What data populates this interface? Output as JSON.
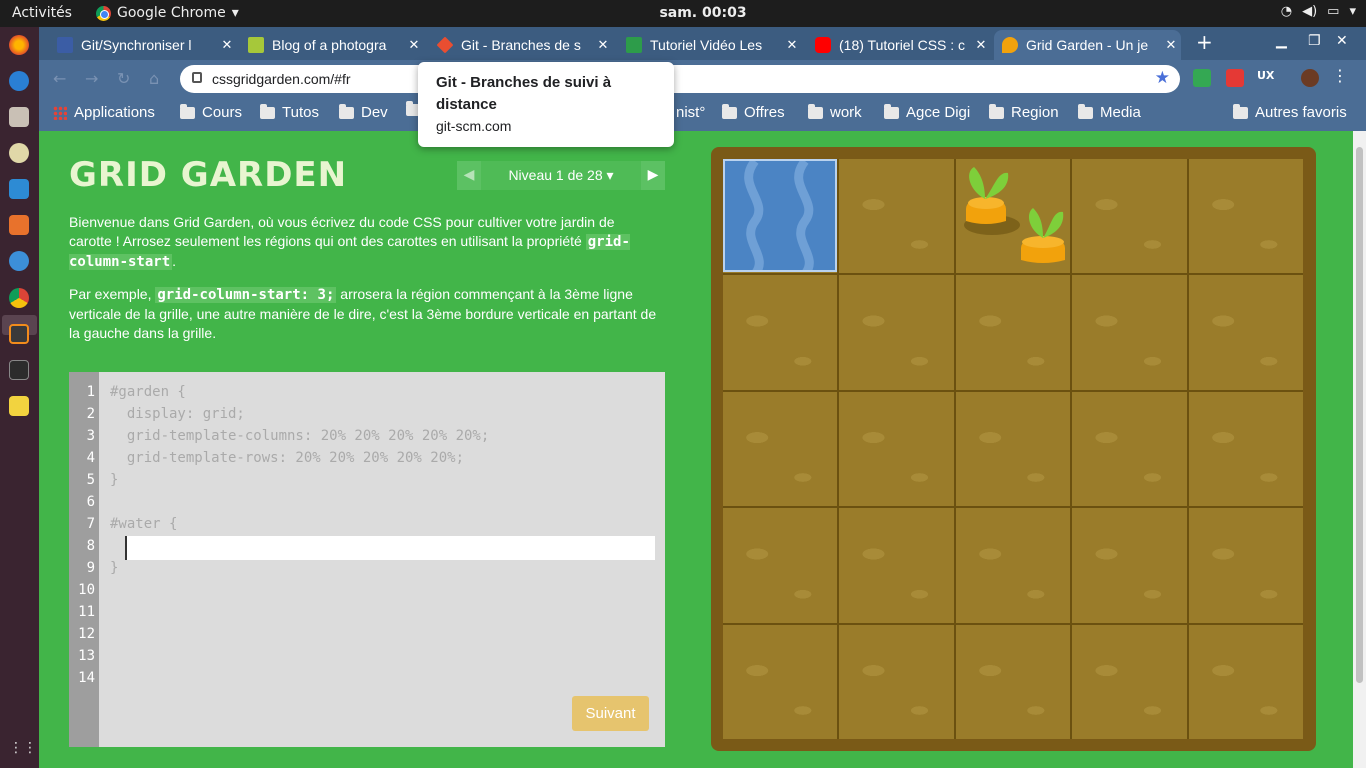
{
  "system": {
    "activities": "Activités",
    "app_name": "Google Chrome",
    "clock": "sam. 00:03"
  },
  "tabs": [
    {
      "title": "Git/Synchroniser l",
      "active": false
    },
    {
      "title": "Blog of a photogra",
      "active": false
    },
    {
      "title": "Git - Branches de s",
      "active": false
    },
    {
      "title": "Tutoriel Vidéo Les",
      "active": false
    },
    {
      "title": "(18) Tutoriel CSS : c",
      "active": false
    },
    {
      "title": "Grid Garden - Un je",
      "active": true
    }
  ],
  "new_tab_label": "+",
  "address_bar": {
    "url": "cssgridgarden.com/#fr"
  },
  "bookmarks": {
    "apps_label": "Applications",
    "folders": [
      "Cours",
      "Tutos",
      "Dev",
      "",
      "nist°",
      "Offres",
      "work",
      "Agce Digi",
      "Region",
      "Media"
    ],
    "other": "Autres favoris"
  },
  "tooltip": {
    "title": "Git - Branches de suivi à distance",
    "domain": "git-scm.com"
  },
  "game": {
    "title": "GRID GARDEN",
    "level_label": "Niveau 1 de 28 ▾",
    "prev_arrow": "◀",
    "next_arrow": "▶",
    "intro_1": "Bienvenue dans Grid Garden, où vous écrivez du code CSS pour cultiver votre jardin de carotte ! Arrosez seulement les régions qui ont des carottes en utilisant la propriété ",
    "intro_code": "grid-column-start",
    "intro_end": ".",
    "example_1": "Par exemple, ",
    "example_code": "grid-column-start: 3;",
    "example_2": " arrosera la région commençant à la 3ème ligne verticale de la grille, une autre manière de le dire, c'est la 3ème bordure verticale en partant de la gauche dans la grille.",
    "next_button": "Suivant",
    "code_lines": [
      "#garden {",
      "  display: grid;",
      "  grid-template-columns: 20% 20% 20% 20% 20%;",
      "  grid-template-rows: 20% 20% 20% 20% 20%;",
      "}",
      "",
      "#water {",
      "",
      "}",
      "",
      "",
      "",
      "",
      ""
    ],
    "line_numbers": [
      "1",
      "2",
      "3",
      "4",
      "5",
      "6",
      "7",
      "8",
      "9",
      "10",
      "11",
      "12",
      "13",
      "14"
    ],
    "input_value": ""
  },
  "colors": {
    "page_bg": "#42b549",
    "soil": "#9a7c2a",
    "water": "#4b84c4",
    "carrot": "#f2a20c",
    "leaf": "#7ecf3a"
  }
}
